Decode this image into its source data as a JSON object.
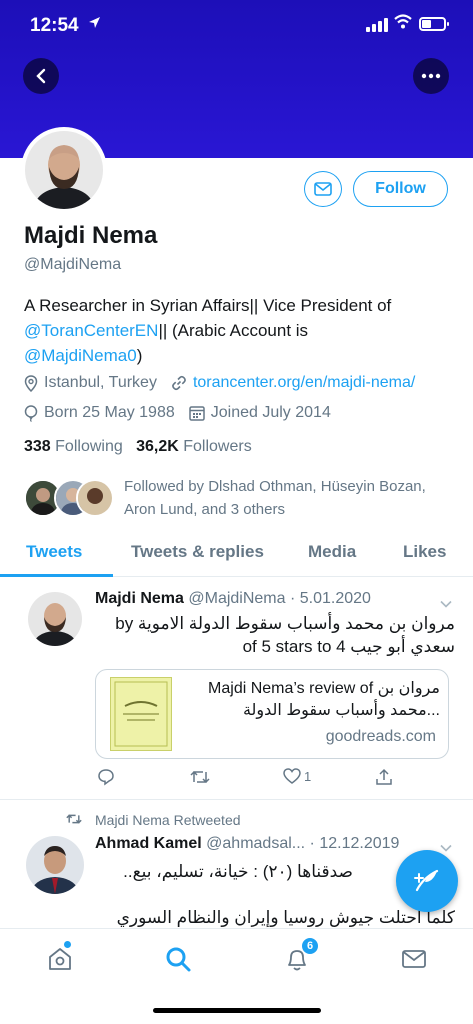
{
  "status_bar": {
    "time": "12:54"
  },
  "profile": {
    "name": "Majdi Nema",
    "handle": "@MajdiNema",
    "bio_text_1": "A Researcher in Syrian Affairs|| Vice President of ",
    "bio_link_1": "@ToranCenterEN",
    "bio_text_2": "|| (Arabic Account is ",
    "bio_link_2": "@MajdiNema0",
    "bio_text_3": ")",
    "location": "Istanbul, Turkey",
    "website": "torancenter.org/en/majdi-nema/",
    "born": "Born 25 May 1988",
    "joined": "Joined July 2014",
    "following_count": "338",
    "following_label": "Following",
    "followers_count": "36,2K",
    "followers_label": "Followers",
    "followed_by": "Followed by Dlshad Othman, Hüseyin Bozan, Aron Lund, and 3 others"
  },
  "buttons": {
    "follow": "Follow"
  },
  "tabs": [
    {
      "label": "Tweets"
    },
    {
      "label": "Tweets & replies"
    },
    {
      "label": "Media"
    },
    {
      "label": "Likes"
    }
  ],
  "tweets": [
    {
      "name": "Majdi Nema",
      "handle": "@MajdiNema · 5.01.2020",
      "body": "مروان بن محمد وأسباب سقوط الدولة الاموية by سعدي أبو جيب of 5 stars to 4",
      "card_title": "Majdi Nema’s review of مروان بن محمد وأسباب سقوط الدولة...",
      "card_domain": "goodreads.com",
      "like_count": "1"
    },
    {
      "retweet_label": "Majdi Nema Retweeted",
      "name": "Ahmad Kamel",
      "handle": "@ahmadsal... · 12.12.2019",
      "body_line1": "صدقناها (٢٠) : خيانة، تسليم، بيع..",
      "body_line2": "كلما احتلت جيوش روسيا وإيران والنظام السوري"
    }
  ],
  "nav": {
    "notifications_badge": "6"
  },
  "colors": {
    "accent": "#1da1f2",
    "banner": "#2413c9"
  }
}
